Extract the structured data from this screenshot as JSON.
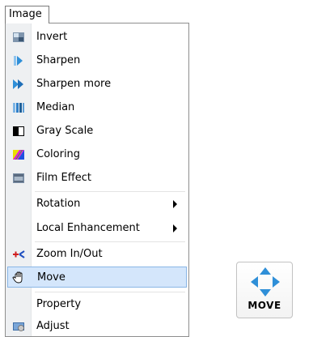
{
  "menubar": {
    "title": "Image"
  },
  "menu": {
    "items": [
      {
        "label": "Invert",
        "icon": "invert-icon"
      },
      {
        "label": "Sharpen",
        "icon": "sharpen-icon"
      },
      {
        "label": "Sharpen more",
        "icon": "sharpen-more-icon"
      },
      {
        "label": "Median",
        "icon": "median-icon"
      },
      {
        "label": "Gray Scale",
        "icon": "gray-scale-icon"
      },
      {
        "label": "Coloring",
        "icon": "coloring-icon"
      },
      {
        "label": "Film Effect",
        "icon": "film-effect-icon"
      },
      {
        "label": "Rotation",
        "submenu": true
      },
      {
        "label": "Local Enhancement",
        "submenu": true
      },
      {
        "label": "Zoom In/Out",
        "icon": "zoom-icon"
      },
      {
        "label": "Move",
        "icon": "hand-icon",
        "selected": true
      },
      {
        "label": "Property"
      },
      {
        "label": "Adjust",
        "icon": "adjust-icon"
      }
    ]
  },
  "move_button": {
    "label": "MOVE",
    "icon": "move-arrows-icon"
  },
  "colors": {
    "selection_bg": "#d4e6fb",
    "selection_border": "#8ab6e6",
    "gutter": "#eef0f2",
    "arrow_blue": "#2f8fd8"
  }
}
